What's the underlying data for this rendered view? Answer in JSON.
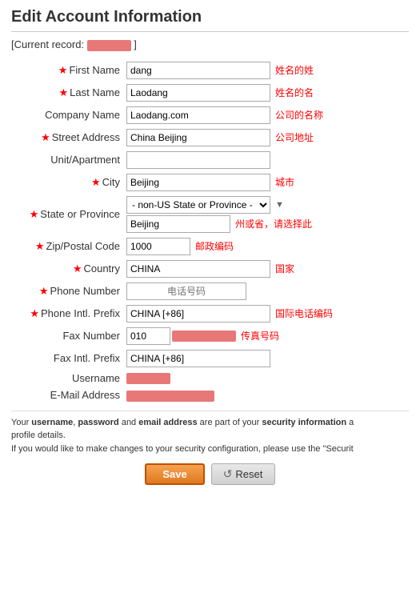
{
  "page": {
    "title": "Edit Account Information",
    "current_record_label": "[Current record:",
    "current_record_bracket_close": "]"
  },
  "form": {
    "first_name_label": "First Name",
    "first_name_value": "dang",
    "first_name_note": "姓名的姓",
    "last_name_label": "Last Name",
    "last_name_value": "Laodang",
    "last_name_note": "姓名的名",
    "company_name_label": "Company Name",
    "company_name_value": "Laodang.com",
    "company_name_note": "公司的名称",
    "street_address_label": "Street Address",
    "street_address_value": "China Beijing",
    "street_address_note": "公司地址",
    "unit_label": "Unit/Apartment",
    "unit_value": "",
    "city_label": "City",
    "city_value": "Beijing",
    "city_note": "城市",
    "state_label": "State or Province",
    "state_select_value": "- non-US State or Province -",
    "state_input_value": "Beijing",
    "state_note": "州或省，请选择此",
    "zip_label": "Zip/Postal Code",
    "zip_value": "1000",
    "zip_note": "邮政编码",
    "country_label": "Country",
    "country_value": "CHINA",
    "country_note": "国家",
    "phone_label": "Phone Number",
    "phone_note": "电话号码",
    "phone_intl_label": "Phone Intl. Prefix",
    "phone_intl_value": "CHINA [+86]",
    "phone_intl_note": "国际电话编码",
    "fax_label": "Fax Number",
    "fax_value": "010",
    "fax_note": "传真号码",
    "fax_intl_label": "Fax Intl. Prefix",
    "fax_intl_value": "CHINA [+86]",
    "username_label": "Username",
    "email_label": "E-Mail Address"
  },
  "security_note": {
    "line1": "Your username, password and email address are part of your security information a",
    "line1_suffix": "profile details.",
    "line2": "If you would like to make changes to your security configuration, please use the \"Securit"
  },
  "buttons": {
    "save_label": "Save",
    "reset_label": "Reset"
  }
}
